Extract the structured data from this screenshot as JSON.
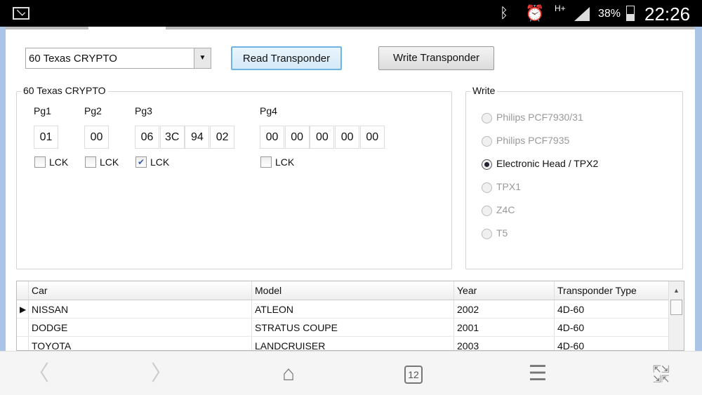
{
  "status_bar": {
    "battery": "38%",
    "time": "22:26",
    "network": "H+",
    "icons": [
      "mail-icon",
      "bluetooth-icon",
      "alarm-icon",
      "signal-icon",
      "battery-icon"
    ]
  },
  "toolbar": {
    "transponder_select": "60 Texas CRYPTO",
    "read_button": "Read Transponder",
    "write_button": "Write Transponder"
  },
  "data_group": {
    "title": "60 Texas CRYPTO",
    "pages": [
      {
        "label": "Pg1",
        "bytes": [
          "01"
        ],
        "lock_label": "LCK",
        "locked": false
      },
      {
        "label": "Pg2",
        "bytes": [
          "00"
        ],
        "lock_label": "LCK",
        "locked": false
      },
      {
        "label": "Pg3",
        "bytes": [
          "06",
          "3C",
          "94",
          "02"
        ],
        "lock_label": "LCK",
        "locked": true
      },
      {
        "label": "Pg4",
        "bytes": [
          "00",
          "00",
          "00",
          "00",
          "00"
        ],
        "lock_label": "LCK",
        "locked": false
      }
    ]
  },
  "write_group": {
    "title": "Write",
    "options": [
      {
        "label": "Philips PCF7930/31",
        "selected": false,
        "enabled": false
      },
      {
        "label": "Philips PCF7935",
        "selected": false,
        "enabled": false
      },
      {
        "label": "Electronic Head / TPX2",
        "selected": true,
        "enabled": true
      },
      {
        "label": "TPX1",
        "selected": false,
        "enabled": false
      },
      {
        "label": "Z4C",
        "selected": false,
        "enabled": false
      },
      {
        "label": "T5",
        "selected": false,
        "enabled": false
      }
    ]
  },
  "table": {
    "columns": [
      "Car",
      "Model",
      "Year",
      "Transponder Type"
    ],
    "rows": [
      [
        "NISSAN",
        "ATLEON",
        "2002",
        "4D-60"
      ],
      [
        "DODGE",
        "STRATUS COUPE",
        "2001",
        "4D-60"
      ],
      [
        "TOYOTA",
        "LANDCRUISER",
        "2003",
        "4D-60"
      ]
    ]
  },
  "browser_nav": {
    "tab_count": "12"
  }
}
